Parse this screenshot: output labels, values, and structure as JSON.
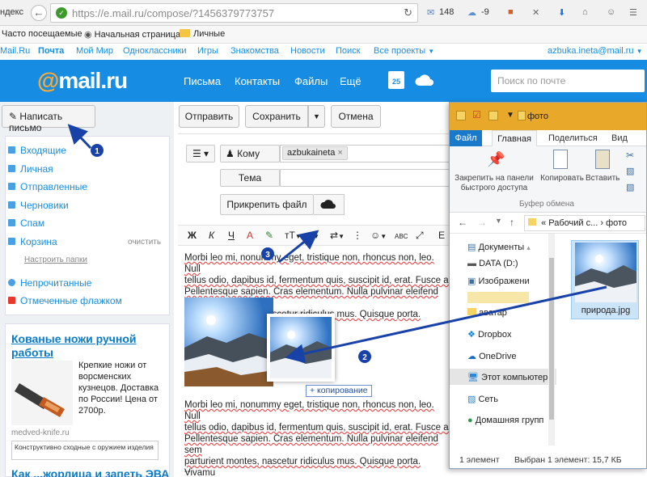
{
  "browser": {
    "brand_fragment": "ндекс",
    "url": "https://e.mail.ru/compose/?1456379773757",
    "indicators": {
      "mail_count": "148",
      "weather": "-9"
    },
    "bookmarks": [
      "Часто посещаемые",
      "Начальная страница",
      "Личные"
    ]
  },
  "portal": {
    "links": [
      "Mail.Ru",
      "Почта",
      "Мой Мир",
      "Одноклассники",
      "Игры",
      "Знакомства",
      "Новости",
      "Поиск",
      "Все проекты"
    ],
    "user_email": "azbuka.ineta@mail.ru"
  },
  "header": {
    "logo_at": "@",
    "logo_text": "mail.ru",
    "nav": [
      "Письма",
      "Контакты",
      "Файлы",
      "Ещё"
    ],
    "calendar_day": "25",
    "search_placeholder": "Поиск по почте"
  },
  "sidebar": {
    "compose_label": "Написать письмо",
    "folders": [
      "Входящие",
      "Личная",
      "Отправленные",
      "Черновики",
      "Спам",
      "Корзина"
    ],
    "trash_action": "очистить",
    "settings_link": "Настроить папки",
    "filters": [
      "Непрочитанные",
      "Отмеченные флажком"
    ]
  },
  "ad": {
    "title": "Кованые ножи ручной работы",
    "text": "Крепкие ножи от ворсменских кузнецов. Доставка по России! Цена от 2700р.",
    "source": "medved-knife.ru",
    "select_text": "Конструктивно сходные с оружием изделия",
    "next_title": "Как ...жорлица и запеть ЭВА"
  },
  "toolbar": {
    "send": "Отправить",
    "save": "Сохранить",
    "cancel": "Отмена"
  },
  "compose": {
    "to_label": "Кому",
    "recipient": "azbukaineta",
    "subject_label": "Тема",
    "attach_label": "Прикрепить файл",
    "format_buttons": [
      "Ж",
      "К",
      "Ч",
      "А"
    ],
    "text_size_label": "тТ",
    "copy_tooltip": "+ копирование",
    "body_block_1": [
      "Morbi leo mi, nonummy eget, tristique non, rhoncus non, leo. Null",
      "tellus odio, dapibus id, fermentum quis, suscipit id, erat. Fusce al",
      "Pellentesque sapien. Cras elementum. Nulla pulvinar eleifend sem",
      "parturient montes, nascetur ridiculus mus. Quisque porta. Vivamu"
    ],
    "body_block_2": [
      " Morbi leo mi, nonummy eget, tristique non, rhoncus non, leo. Null",
      "tellus odio, dapibus id, fermentum quis, suscipit id, erat. Fusce al",
      "Pellentesque sapien. Cras elementum. Nulla pulvinar eleifend sem",
      "parturient montes, nascetur ridiculus mus. Quisque porta. Vivamu"
    ],
    "signature": "--"
  },
  "explorer": {
    "title": "фото",
    "tabs": [
      "Файл",
      "Главная",
      "Поделиться",
      "Вид"
    ],
    "ribbon": {
      "pin": "Закрепить на панели быстрого доступа",
      "copy": "Копировать",
      "paste": "Вставить",
      "group": "Буфер обмена"
    },
    "path": [
      "Рабочий с...",
      "фото"
    ],
    "tree": [
      "Документы",
      "DATA (D:)",
      "Изображени",
      "",
      "аватар",
      "Dropbox",
      "OneDrive",
      "Этот компьютер",
      "Сеть",
      "Домашняя групп"
    ],
    "file_name": "природа.jpg",
    "status": [
      "1 элемент",
      "Выбран 1 элемент: 15,7 КБ"
    ]
  },
  "annotations": [
    "1",
    "2",
    "3"
  ],
  "colors": {
    "accent": "#168de2",
    "logo_orange": "#ffa930",
    "arrow": "#1842a8"
  }
}
